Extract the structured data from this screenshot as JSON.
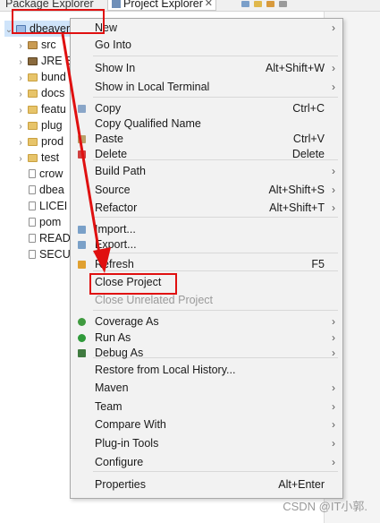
{
  "tabs": [
    {
      "label": "Package Explorer",
      "active": false
    },
    {
      "label": "Project Explorer",
      "active": true,
      "close": "✕"
    }
  ],
  "tree": {
    "root": {
      "label": "dbeaver",
      "expander": "⌄",
      "icon": "project-icon"
    },
    "items": [
      {
        "label": "src",
        "icon": "package-folder-icon",
        "expander": "›"
      },
      {
        "label": "JRE S",
        "icon": "library-icon",
        "expander": "›"
      },
      {
        "label": "bund",
        "icon": "folder-icon",
        "expander": "›"
      },
      {
        "label": "docs",
        "icon": "folder-icon",
        "expander": "›"
      },
      {
        "label": "featu",
        "icon": "folder-icon",
        "expander": "›"
      },
      {
        "label": "plug",
        "icon": "folder-icon",
        "expander": "›"
      },
      {
        "label": "prod",
        "icon": "folder-icon",
        "expander": "›"
      },
      {
        "label": "test",
        "icon": "folder-icon",
        "expander": "›"
      },
      {
        "label": "crow",
        "icon": "file-icon",
        "expander": ""
      },
      {
        "label": "dbea",
        "icon": "file-icon",
        "expander": ""
      },
      {
        "label": "LICEI",
        "icon": "file-icon",
        "expander": ""
      },
      {
        "label": "pom",
        "icon": "file-icon",
        "expander": ""
      },
      {
        "label": "READ",
        "icon": "file-icon",
        "expander": ""
      },
      {
        "label": "SECU",
        "icon": "file-icon",
        "expander": ""
      }
    ]
  },
  "menu": {
    "submenu_glyph": "›",
    "items": [
      {
        "label": "New",
        "accel": "",
        "submenu": true
      },
      {
        "label": "Go Into",
        "accel": "",
        "submenu": false
      },
      {
        "label": "Show In",
        "accel": "Alt+Shift+W",
        "submenu": true
      },
      {
        "label": "Show in Local Terminal",
        "accel": "",
        "submenu": true
      },
      {
        "label": "Copy",
        "accel": "Ctrl+C",
        "submenu": false,
        "icon": "copy-icon"
      },
      {
        "label": "Copy Qualified Name",
        "accel": "",
        "submenu": false
      },
      {
        "label": "Paste",
        "accel": "Ctrl+V",
        "submenu": false,
        "icon": "paste-icon"
      },
      {
        "label": "Delete",
        "accel": "Delete",
        "submenu": false,
        "icon": "delete-icon"
      },
      {
        "label": "Build Path",
        "accel": "",
        "submenu": true
      },
      {
        "label": "Source",
        "accel": "Alt+Shift+S",
        "submenu": true
      },
      {
        "label": "Refactor",
        "accel": "Alt+Shift+T",
        "submenu": true
      },
      {
        "label": "Import...",
        "accel": "",
        "submenu": false,
        "icon": "import-icon"
      },
      {
        "label": "Export...",
        "accel": "",
        "submenu": false,
        "icon": "export-icon"
      },
      {
        "label": "Refresh",
        "accel": "F5",
        "submenu": false,
        "icon": "refresh-icon"
      },
      {
        "label": "Close Project",
        "accel": "",
        "submenu": false
      },
      {
        "label": "Close Unrelated Project",
        "accel": "",
        "submenu": false,
        "disabled": true
      },
      {
        "label": "Coverage As",
        "accel": "",
        "submenu": true,
        "icon": "coverage-icon"
      },
      {
        "label": "Run As",
        "accel": "",
        "submenu": true,
        "icon": "run-icon"
      },
      {
        "label": "Debug As",
        "accel": "",
        "submenu": true,
        "icon": "debug-icon"
      },
      {
        "label": "Restore from Local History...",
        "accel": "",
        "submenu": false
      },
      {
        "label": "Maven",
        "accel": "",
        "submenu": true
      },
      {
        "label": "Team",
        "accel": "",
        "submenu": true
      },
      {
        "label": "Compare With",
        "accel": "",
        "submenu": true
      },
      {
        "label": "Plug-in Tools",
        "accel": "",
        "submenu": true
      },
      {
        "label": "Configure",
        "accel": "",
        "submenu": true
      },
      {
        "label": "Properties",
        "accel": "Alt+Enter",
        "submenu": false
      }
    ]
  },
  "annotation_color": "#e01010",
  "watermark": "CSDN @IT小郭."
}
